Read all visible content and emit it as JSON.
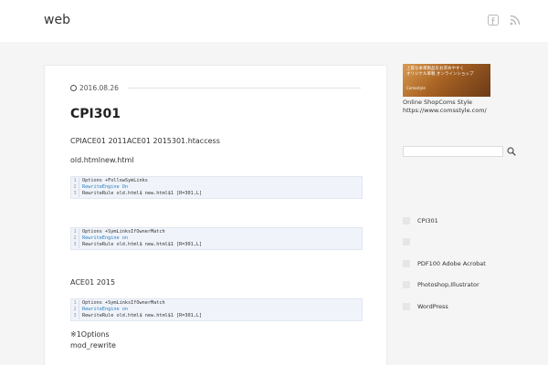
{
  "header": {
    "site_title": "web",
    "icons": [
      "facebook-icon",
      "rss-icon"
    ]
  },
  "post": {
    "date": "2016.08.26",
    "title": "CPI301",
    "intro": "CPIACE01 2011ACE01 2015301.htaccess",
    "files": "old.htmlnew.html",
    "code1": [
      {
        "n": "1",
        "text": "Options +FollowSymLinks"
      },
      {
        "n": "2",
        "text": "RewriteEngine On"
      },
      {
        "n": "3",
        "text": "RewriteRule old.html$ new.html$1 [R=301,L]"
      }
    ],
    "code2": [
      {
        "n": "1",
        "text": "Options +SymLinksIfOwnerMatch"
      },
      {
        "n": "2",
        "text": "RewriteEngine on"
      },
      {
        "n": "3",
        "text": "RewriteRule old.html$ new.html$1 [R=301,L]"
      }
    ],
    "ace_text": "ACE01 2015",
    "code3": [
      {
        "n": "1",
        "text": "Options +SymLinksIfOwnerMatch"
      },
      {
        "n": "2",
        "text": "RewriteEngine on"
      },
      {
        "n": "3",
        "text": "RewriteRule old.html$ new.html$1 [R=301,L]"
      }
    ],
    "note1": "※1Options",
    "note2": "mod_rewrite"
  },
  "sidebar": {
    "banner_line1": "上質な本革製品をお求めやすく",
    "banner_line2": "オリジナル革製 オンラインショップ",
    "banner_sub": "Comsstyle",
    "caption": "Online ShopComs Style",
    "url": "https://www.comsstyle.com/",
    "search_placeholder": "",
    "items": [
      {
        "label": "CPI301"
      },
      {
        "label": ""
      },
      {
        "label": "PDF100 Adobe Acrobat"
      },
      {
        "label": "Photoshop,Illustrator"
      },
      {
        "label": "WordPress"
      }
    ]
  },
  "colors": {
    "background": "#f5f5f5",
    "code_bg": "#f0f4fa",
    "code_string": "#2a7fbf"
  }
}
